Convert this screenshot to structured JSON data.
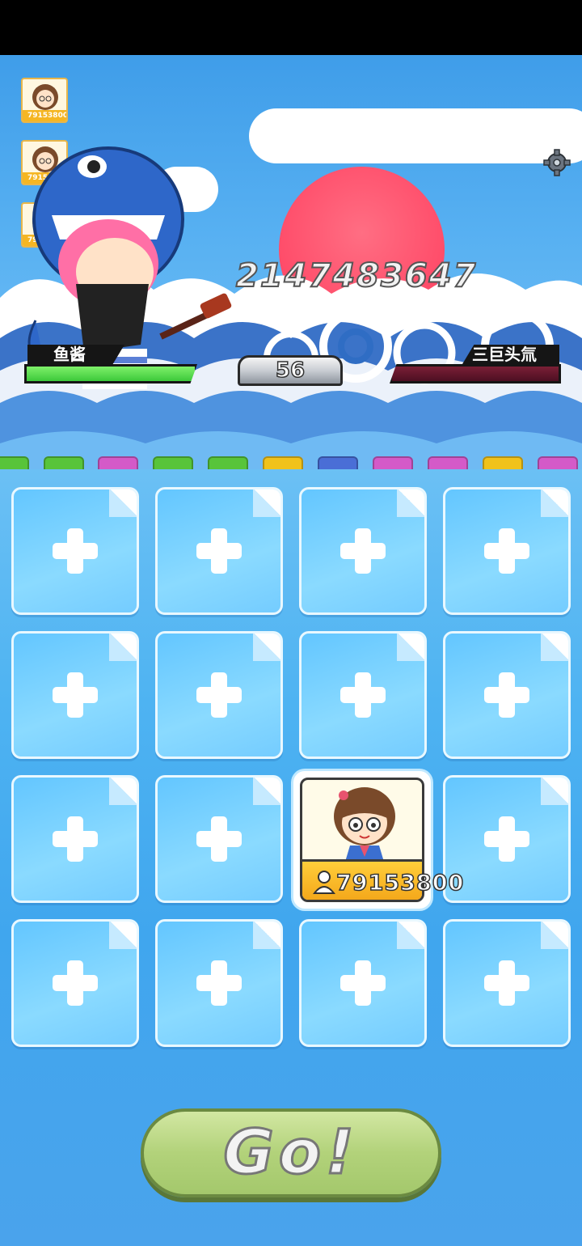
{
  "game": {
    "player_name": "鱼酱",
    "enemy_name": "三巨头氚",
    "level": "56",
    "damage_number": "2147483647",
    "go_label": "Go!"
  },
  "ranking": [
    {
      "score": "79153800"
    },
    {
      "score": "79153800"
    },
    {
      "score": "79153800"
    }
  ],
  "items": [
    {
      "name": "key-item",
      "color": "#58c43a"
    },
    {
      "name": "gun-item",
      "color": "#58c43a"
    },
    {
      "name": "calculator-item",
      "color": "#d45ac8"
    },
    {
      "name": "panda-item",
      "color": "#58c43a"
    },
    {
      "name": "book-item",
      "color": "#58c43a"
    },
    {
      "name": "lemon-item",
      "color": "#f1c21b"
    },
    {
      "name": "scroll-item",
      "color": "#4a6ed6"
    },
    {
      "name": "purple-orb-item",
      "color": "#d45ac8"
    },
    {
      "name": "robot-item",
      "color": "#d45ac8"
    },
    {
      "name": "lamp-item",
      "color": "#f1c21b"
    },
    {
      "name": "purple-orb-item-2",
      "color": "#d45ac8"
    }
  ],
  "board": {
    "card_score": "79153800"
  }
}
